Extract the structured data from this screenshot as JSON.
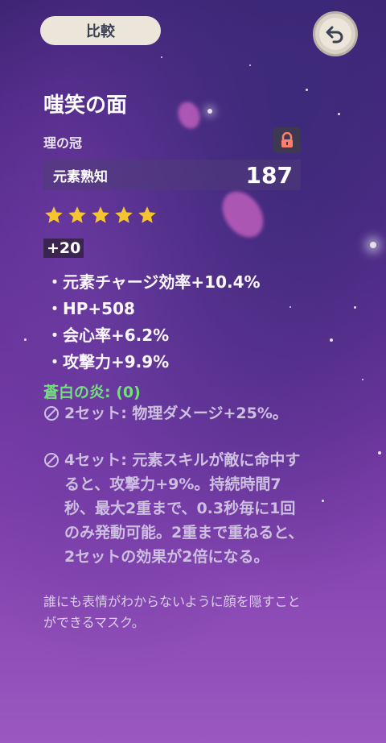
{
  "header": {
    "compare_label": "比較",
    "back_icon": "return-arrow-icon"
  },
  "artifact": {
    "name": "嗤笑の面",
    "slot": "理の冠",
    "locked": true,
    "main_stat": {
      "label": "元素熟知",
      "value": "187"
    },
    "rarity": 5,
    "level": "+20",
    "substats": [
      "・元素チャージ効率+10.4%",
      "・HP+508",
      "・会心率+6.2%",
      "・攻撃力+9.9%"
    ],
    "set": {
      "name": "蒼白の炎: (0)",
      "effects": [
        "2セット: 物理ダメージ+25%。",
        "4セット: 元素スキルが敵に命中すると、攻撃力+9%。持続時間7秒、最大2重まで、0.3秒毎に1回のみ発動可能。2重まで重ねると、2セットの効果が2倍になる。"
      ]
    },
    "description": "誰にも表情がわからないように顔を隠すことができるマスク。"
  },
  "colors": {
    "set_name": "#72e07a",
    "star": "#f5c531",
    "lock": "#ff7d6b"
  }
}
